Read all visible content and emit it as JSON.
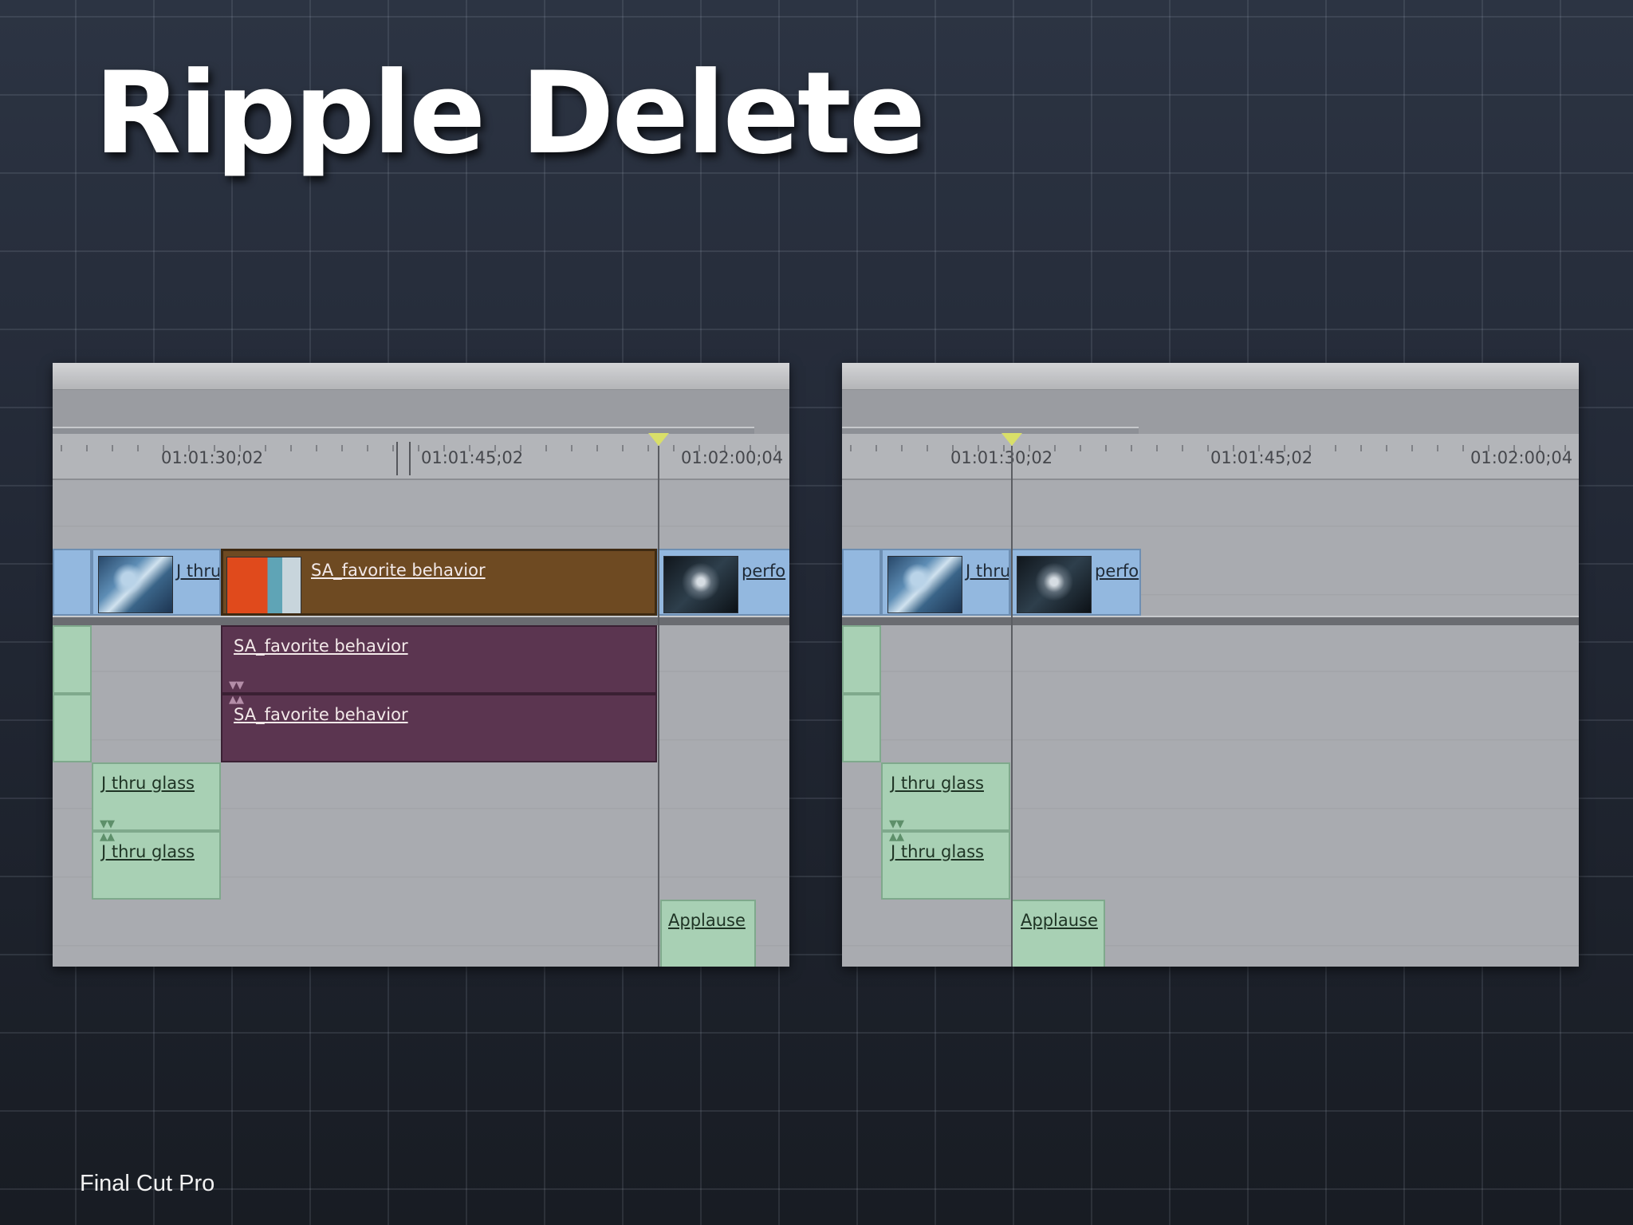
{
  "slide": {
    "title": "Ripple Delete",
    "footer": "Final Cut Pro"
  },
  "before": {
    "timecodes": [
      "01:01:30;02",
      "01:01:45;02",
      "01:02:00;04"
    ],
    "video_clips": {
      "j_thru": "J thru",
      "sa_favorite": "SA_favorite behavior",
      "perfo": "perfo"
    },
    "audio_clips": {
      "sa_favorite_1": "SA_favorite behavior",
      "sa_favorite_2": "SA_favorite behavior",
      "j_thru_glass_1": "J thru glass",
      "j_thru_glass_2": "J thru glass",
      "applause": "Applause"
    }
  },
  "after": {
    "timecodes": [
      "01:01:30;02",
      "01:01:45;02",
      "01:02:00;04"
    ],
    "video_clips": {
      "j_thru": "J thru",
      "perfo": "perfo"
    },
    "audio_clips": {
      "j_thru_glass_1": "J thru glass",
      "j_thru_glass_2": "J thru glass",
      "applause": "Applause"
    }
  },
  "colors": {
    "video_clip": "#93b8df",
    "selected_video_clip": "#6e4a22",
    "selected_audio_clip": "#5b3550",
    "audio_clip": "#a8d0b4",
    "playhead": "#d9df69"
  }
}
